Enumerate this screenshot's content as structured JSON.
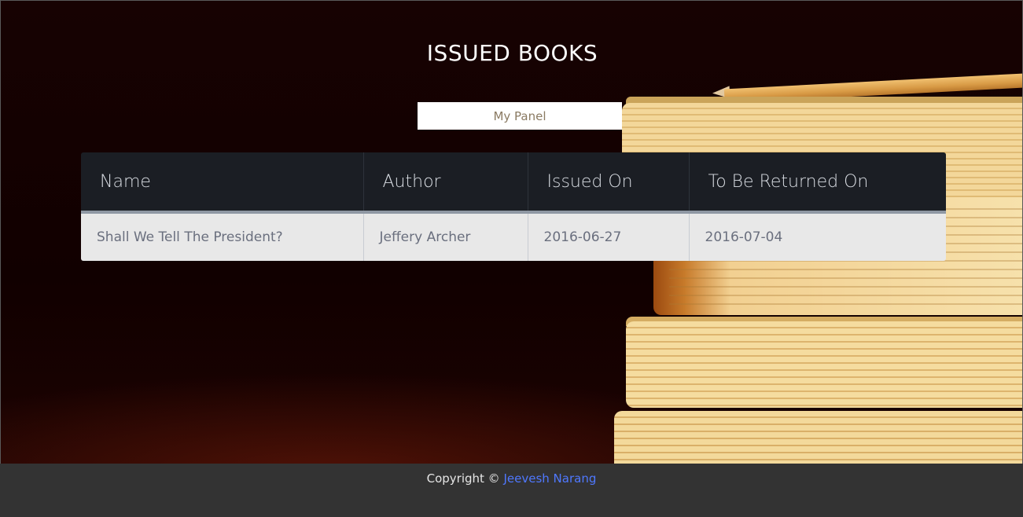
{
  "page": {
    "title": "ISSUED BOOKS"
  },
  "actions": {
    "panel_label": "My Panel"
  },
  "table": {
    "columns": [
      "Name",
      "Author",
      "Issued On",
      "To Be Returned On"
    ],
    "rows": [
      {
        "name": "Shall We Tell The President?",
        "author": "Jeffery Archer",
        "issued_on": "2016-06-27",
        "return_on": "2016-07-04"
      }
    ]
  },
  "footer": {
    "copyright_label": "Copyright ©",
    "author_link": "Jeevesh Narang"
  },
  "colors": {
    "header_bg": "#1b1e24",
    "row_bg": "#e8e8e8",
    "footer_bg": "#333333",
    "link": "#4f78ff"
  }
}
